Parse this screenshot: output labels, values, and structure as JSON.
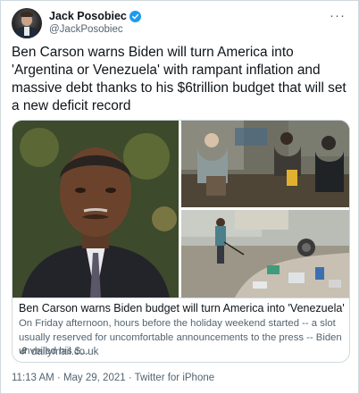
{
  "author": {
    "display_name": "Jack Posobiec",
    "handle": "@JackPosobiec",
    "verified": true
  },
  "tweet": {
    "text": "Ben Carson warns Biden will turn America into 'Argentina or Venezuela' with rampant inflation and massive debt thanks to his $6trillion budget that will set a new deficit record"
  },
  "link_card": {
    "title": "Ben Carson warns Biden budget will turn America into 'Venezuela'",
    "description": "On Friday afternoon, hours before the holiday weekend started -- a slot usually reserved for uncomfortable announcements to the press -- Biden unveiled his $...",
    "domain": "dailymail.co.uk"
  },
  "meta": {
    "timestamp": "11:13 AM · May 29, 2021 · Twitter for iPhone"
  },
  "colors": {
    "accent": "#1d9bf0",
    "secondary_text": "#536471",
    "border": "#cfd9de"
  },
  "icons": [
    "verified-badge-icon",
    "more-options-icon",
    "link-icon"
  ]
}
